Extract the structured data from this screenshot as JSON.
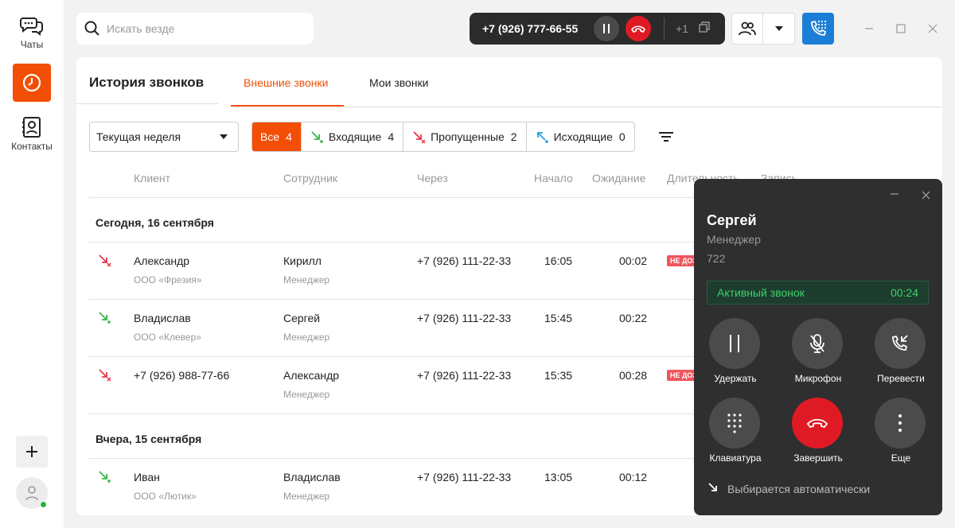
{
  "sidebar": {
    "chats_label": "Чаты",
    "contacts_label": "Контакты",
    "accent": "#f24e05"
  },
  "search": {
    "placeholder": "Искать везде",
    "value": ""
  },
  "callbar": {
    "number": "+7 (926) 777-66-55",
    "plus": "+1"
  },
  "page": {
    "title": "История звонков"
  },
  "tabs": [
    {
      "label": "Внешние звонки"
    },
    {
      "label": "Мои звонки"
    }
  ],
  "period": {
    "selected": "Текущая неделя"
  },
  "filters": [
    {
      "label": "Все",
      "count": "4"
    },
    {
      "label": "Входящие",
      "count": "4"
    },
    {
      "label": "Пропущенные",
      "count": "2"
    },
    {
      "label": "Исходящие",
      "count": "0"
    }
  ],
  "columns": [
    "Клиент",
    "Сотрудник",
    "Через",
    "Начало",
    "Ожидание",
    "Длительность",
    "Запись"
  ],
  "groups": [
    {
      "title": "Сегодня, 16 сентября",
      "rows": [
        {
          "direction": "missed",
          "client": "Александр",
          "company": "ООО «Фрезия»",
          "employee": "Кирилл",
          "role": "Менеджер",
          "via": "+7 (926) 111-22-33",
          "start": "16:05",
          "wait": "00:02",
          "tag": "НЕ ДОЗВОНИЛИСЬ"
        },
        {
          "direction": "incoming",
          "client": "Владислав",
          "company": "ООО «Клевер»",
          "employee": "Сергей",
          "role": "Менеджер",
          "via": "+7 (926) 111-22-33",
          "start": "15:45",
          "wait": "00:22"
        },
        {
          "direction": "missed",
          "client": "+7 (926) 988-77-66",
          "employee": "Александр",
          "role": "Менеджер",
          "via": "+7 (926) 111-22-33",
          "start": "15:35",
          "wait": "00:28",
          "tag": "НЕ ДОЗВОНИЛИСЬ"
        }
      ]
    },
    {
      "title": "Вчера, 15 сентября",
      "rows": [
        {
          "direction": "incoming",
          "client": "Иван",
          "company": "ООО «Лютик»",
          "employee": "Владислав",
          "role": "Менеджер",
          "via": "+7 (926) 111-22-33",
          "start": "13:05",
          "wait": "00:12"
        }
      ]
    }
  ],
  "call_panel": {
    "name": "Сергей",
    "role": "Менеджер",
    "ext": "722",
    "status": "Активный звонок",
    "timer": "00:24",
    "buttons": {
      "hold": "Удержать",
      "mic": "Микрофон",
      "transfer": "Перевести",
      "keypad": "Клавиатура",
      "end": "Завершить",
      "more": "Еще"
    },
    "auto": "Выбирается автоматически"
  },
  "colors": {
    "incoming": "#3bb54a",
    "missed": "#e8364a",
    "outgoing": "#2d9cdb",
    "status_green": "#3dd16b",
    "end_red": "#e01a24",
    "dialer_blue": "#1b7ed6"
  }
}
